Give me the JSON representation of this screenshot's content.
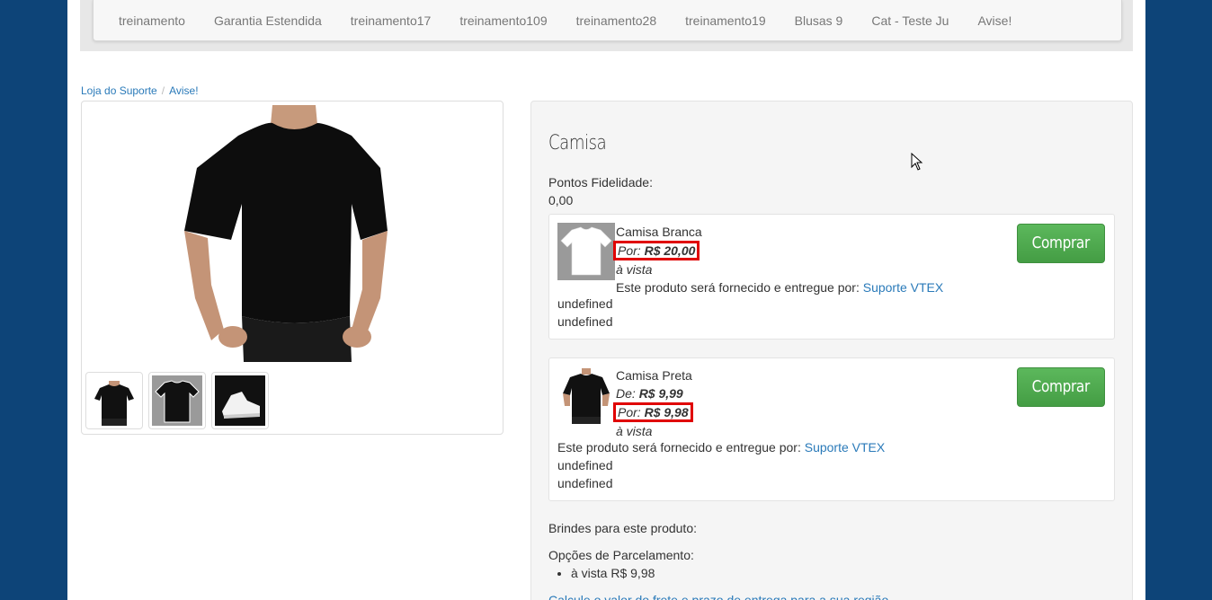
{
  "nav": {
    "items": [
      {
        "label": "treinamento"
      },
      {
        "label": "Garantia Estendida"
      },
      {
        "label": "treinamento17"
      },
      {
        "label": "treinamento109"
      },
      {
        "label": "treinamento28"
      },
      {
        "label": "treinamento19"
      },
      {
        "label": "Blusas 9"
      },
      {
        "label": "Cat - Teste Ju"
      },
      {
        "label": "Avise!"
      }
    ]
  },
  "breadcrumb": {
    "items": [
      {
        "label": "Loja do Suporte"
      },
      {
        "label": "Avise!"
      }
    ],
    "separator": "/"
  },
  "product": {
    "title": "Camisa",
    "pontos_label": "Pontos Fidelidade:",
    "pontos_value": "0,00"
  },
  "skus": [
    {
      "name": "Camisa Branca",
      "por_label": "Por:",
      "por_price": "R$ 20,00",
      "a_vista": "à vista",
      "seller_text": "Este produto será fornecido e entregue por:",
      "seller_link": "Suporte VTEX",
      "extra1": "undefined",
      "extra2": "undefined",
      "button": "Comprar"
    },
    {
      "name": "Camisa Preta",
      "de_label": "De:",
      "de_price": "R$ 9,99",
      "por_label": "Por:",
      "por_price": "R$ 9,98",
      "a_vista": "à vista",
      "seller_text": "Este produto será fornecido e entregue por:",
      "seller_link": "Suporte VTEX",
      "extra1": "undefined",
      "extra2": "undefined",
      "button": "Comprar"
    }
  ],
  "brindes_label": "Brindes para este produto:",
  "parcelamento": {
    "label": "Opções de Parcelamento:",
    "options": [
      "à vista R$ 9,98"
    ]
  },
  "frete_link": "Calcule o valor do frete e prazo de entrega para a sua região",
  "colors": {
    "background": "#0d4478",
    "button_green": "#5cb85c",
    "link_blue": "#2a7ab9",
    "highlight_red": "#e00000"
  }
}
